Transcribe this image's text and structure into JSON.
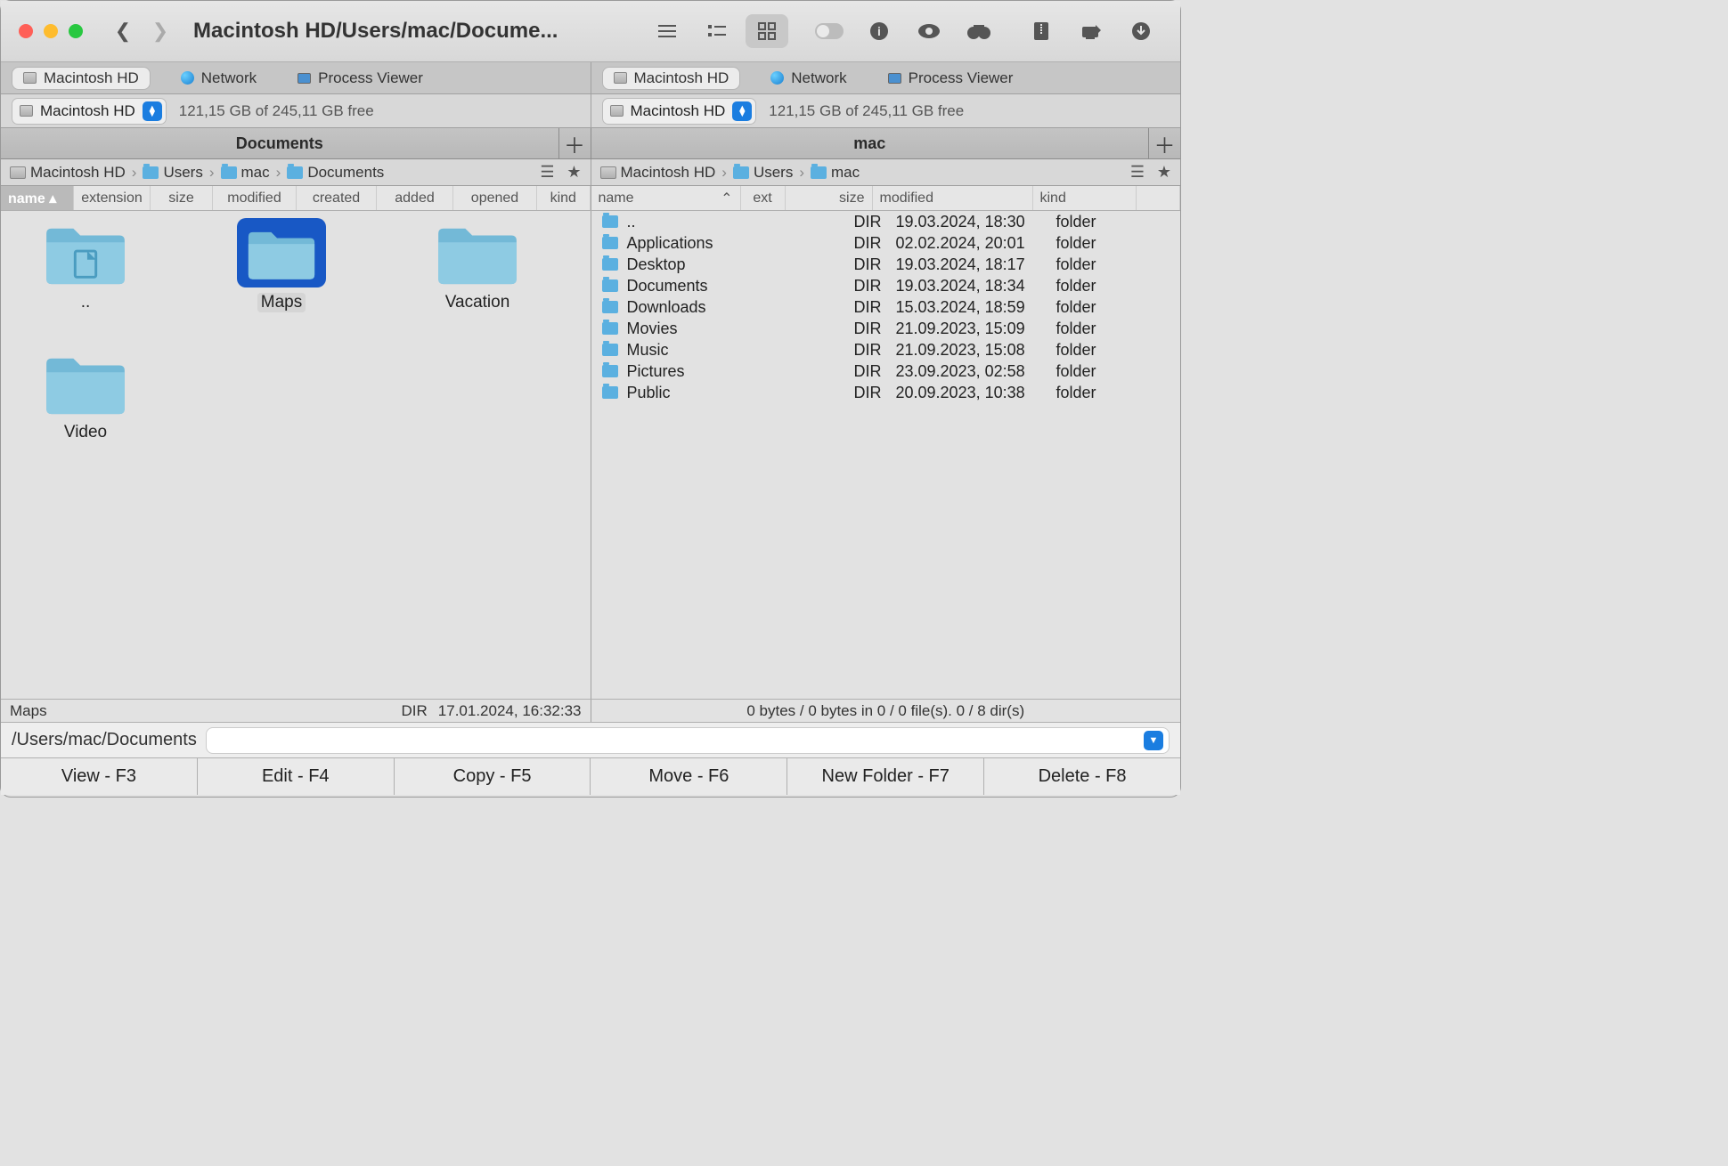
{
  "window": {
    "title": "Macintosh HD/Users/mac/Docume..."
  },
  "toolbar": {
    "tabs_left": [
      {
        "label": "Macintosh HD",
        "active": true
      },
      {
        "label": "Network"
      },
      {
        "label": "Process Viewer"
      }
    ],
    "tabs_right": [
      {
        "label": "Macintosh HD",
        "active": true
      },
      {
        "label": "Network"
      },
      {
        "label": "Process Viewer"
      }
    ]
  },
  "drives": {
    "left": {
      "name": "Macintosh HD",
      "free": "121,15 GB of 245,11 GB free"
    },
    "right": {
      "name": "Macintosh HD",
      "free": "121,15 GB of 245,11 GB free"
    }
  },
  "panel_tabs": {
    "left": "Documents",
    "right": "mac"
  },
  "breadcrumbs": {
    "left": [
      "Macintosh HD",
      "Users",
      "mac",
      "Documents"
    ],
    "right": [
      "Macintosh HD",
      "Users",
      "mac"
    ]
  },
  "headers": {
    "left": [
      "name",
      "extension",
      "size",
      "modified",
      "created",
      "added",
      "opened",
      "kind"
    ],
    "right": [
      "name",
      "ext",
      "size",
      "modified",
      "kind"
    ],
    "left_sorted": "name",
    "right_sorted": "name"
  },
  "left_items": [
    {
      "name": "..",
      "type": "documents-folder"
    },
    {
      "name": "Maps",
      "type": "folder",
      "selected": true
    },
    {
      "name": "Vacation",
      "type": "folder"
    },
    {
      "name": "Video",
      "type": "folder"
    }
  ],
  "right_items": [
    {
      "name": "..",
      "size": "DIR",
      "modified": "19.03.2024, 18:30",
      "kind": "folder"
    },
    {
      "name": "Applications",
      "size": "DIR",
      "modified": "02.02.2024, 20:01",
      "kind": "folder"
    },
    {
      "name": "Desktop",
      "size": "DIR",
      "modified": "19.03.2024, 18:17",
      "kind": "folder"
    },
    {
      "name": "Documents",
      "size": "DIR",
      "modified": "19.03.2024, 18:34",
      "kind": "folder"
    },
    {
      "name": "Downloads",
      "size": "DIR",
      "modified": "15.03.2024, 18:59",
      "kind": "folder"
    },
    {
      "name": "Movies",
      "size": "DIR",
      "modified": "21.09.2023, 15:09",
      "kind": "folder"
    },
    {
      "name": "Music",
      "size": "DIR",
      "modified": "21.09.2023, 15:08",
      "kind": "folder"
    },
    {
      "name": "Pictures",
      "size": "DIR",
      "modified": "23.09.2023, 02:58",
      "kind": "folder"
    },
    {
      "name": "Public",
      "size": "DIR",
      "modified": "20.09.2023, 10:38",
      "kind": "folder"
    }
  ],
  "status": {
    "left": {
      "name": "Maps",
      "size": "DIR",
      "modified": "17.01.2024, 16:32:33"
    },
    "right": "0 bytes / 0 bytes in 0 / 0 file(s). 0 / 8 dir(s)"
  },
  "path_field": "/Users/mac/Documents",
  "bottom_bar": [
    "View - F3",
    "Edit - F4",
    "Copy - F5",
    "Move - F6",
    "New Folder - F7",
    "Delete - F8"
  ]
}
